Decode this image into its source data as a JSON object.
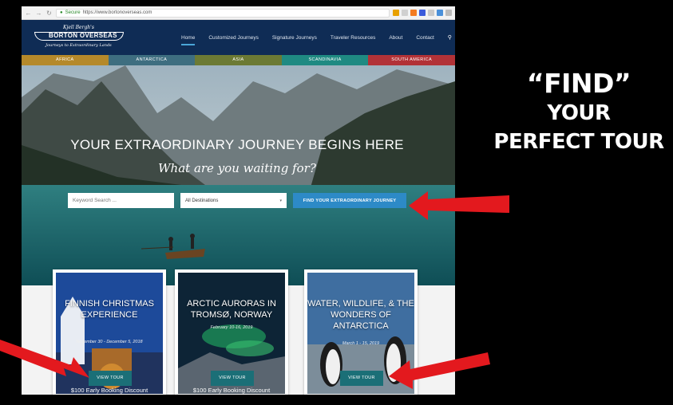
{
  "browser": {
    "secure_label": "Secure",
    "url": "https://www.bortonoverseas.com"
  },
  "site": {
    "logo": {
      "script": "Kjell Bergh's",
      "name": "BORTON OVERSEAS",
      "tagline": "Journeys to Extraordinary Lands"
    },
    "menu": [
      "Home",
      "Customized Journeys",
      "Signature Journeys",
      "Traveler Resources",
      "About",
      "Contact"
    ],
    "regions": [
      {
        "label": "AFRICA",
        "color": "#b5892a"
      },
      {
        "label": "ANTARCTICA",
        "color": "#3e6e80"
      },
      {
        "label": "ASIA",
        "color": "#6c7a34"
      },
      {
        "label": "SCANDINAVIA",
        "color": "#1f8a82"
      },
      {
        "label": "SOUTH AMERICA",
        "color": "#b23237"
      }
    ]
  },
  "hero": {
    "title": "YOUR EXTRAORDINARY JOURNEY BEGINS HERE",
    "subtitle": "What are you waiting for?",
    "search_placeholder": "Keyword Search ...",
    "destination_value": "All Destinations",
    "find_button": "FIND YOUR EXTRAORDINARY JOURNEY"
  },
  "cards": [
    {
      "title": "FINNISH CHRISTMAS EXPERIENCE",
      "dates": "November 30 - December 5, 2018",
      "button": "VIEW TOUR",
      "discount": "$100 Early Booking Discount"
    },
    {
      "title": "ARCTIC AURORAS IN TROMSØ, NORWAY",
      "dates": "February 10-16, 2019",
      "button": "VIEW TOUR",
      "discount": "$100 Early Booking Discount"
    },
    {
      "title": "WATER, WILDLIFE, & THE WONDERS OF ANTARCTICA",
      "dates": "March 1 - 15, 2019",
      "button": "VIEW TOUR",
      "discount": ""
    }
  ],
  "promo": {
    "line1": "“FIND”",
    "line2": "YOUR",
    "line3": "PERFECT TOUR"
  },
  "colors": {
    "header": "#0f2c55",
    "accent_button": "#2d8ac7",
    "view_button": "#1b6f77",
    "arrow": "#e3191e"
  }
}
